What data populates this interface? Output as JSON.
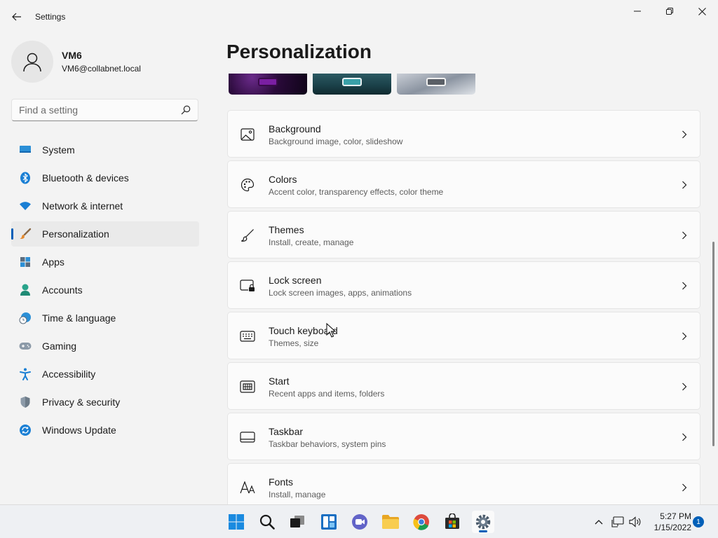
{
  "window": {
    "app_title": "Settings"
  },
  "profile": {
    "name": "VM6",
    "email": "VM6@collabnet.local"
  },
  "search": {
    "placeholder": "Find a setting",
    "value": ""
  },
  "sidebar": {
    "items": [
      {
        "label": "System",
        "icon": "system-icon",
        "active": false
      },
      {
        "label": "Bluetooth & devices",
        "icon": "bluetooth-icon",
        "active": false
      },
      {
        "label": "Network & internet",
        "icon": "wifi-icon",
        "active": false
      },
      {
        "label": "Personalization",
        "icon": "brush-icon",
        "active": true
      },
      {
        "label": "Apps",
        "icon": "apps-icon",
        "active": false
      },
      {
        "label": "Accounts",
        "icon": "accounts-icon",
        "active": false
      },
      {
        "label": "Time & language",
        "icon": "clock-globe-icon",
        "active": false
      },
      {
        "label": "Gaming",
        "icon": "gamepad-icon",
        "active": false
      },
      {
        "label": "Accessibility",
        "icon": "accessibility-icon",
        "active": false
      },
      {
        "label": "Privacy & security",
        "icon": "shield-icon",
        "active": false
      },
      {
        "label": "Windows Update",
        "icon": "update-icon",
        "active": false
      }
    ]
  },
  "main": {
    "title": "Personalization",
    "cards": [
      {
        "title": "Background",
        "subtitle": "Background image, color, slideshow",
        "icon": "image-icon"
      },
      {
        "title": "Colors",
        "subtitle": "Accent color, transparency effects, color theme",
        "icon": "palette-icon"
      },
      {
        "title": "Themes",
        "subtitle": "Install, create, manage",
        "icon": "brush-icon"
      },
      {
        "title": "Lock screen",
        "subtitle": "Lock screen images, apps, animations",
        "icon": "lock-screen-icon"
      },
      {
        "title": "Touch keyboard",
        "subtitle": "Themes, size",
        "icon": "keyboard-icon"
      },
      {
        "title": "Start",
        "subtitle": "Recent apps and items, folders",
        "icon": "start-icon"
      },
      {
        "title": "Taskbar",
        "subtitle": "Taskbar behaviors, system pins",
        "icon": "taskbar-icon"
      },
      {
        "title": "Fonts",
        "subtitle": "Install, manage",
        "icon": "fonts-icon"
      }
    ]
  },
  "taskbar": {
    "time": "5:27 PM",
    "date": "1/15/2022",
    "notification_count": "1"
  },
  "colors": {
    "accent": "#005fb8",
    "background": "#f3f3f3",
    "card": "#fbfbfb"
  }
}
